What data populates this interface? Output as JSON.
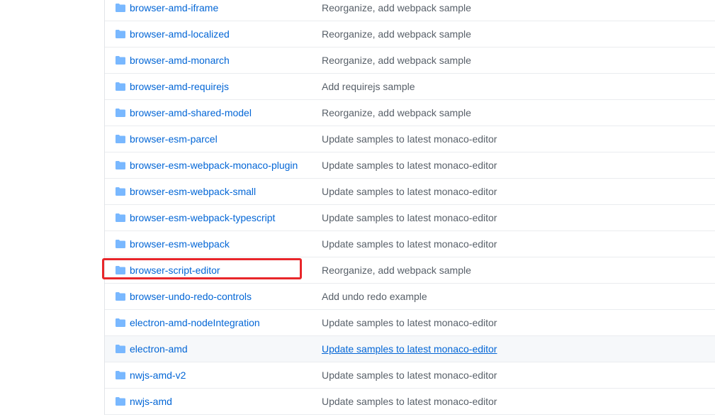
{
  "file_list": {
    "rows": [
      {
        "icon": "folder-icon",
        "name": "browser-amd-iframe",
        "message": "Reorganize, add webpack sample"
      },
      {
        "icon": "folder-icon",
        "name": "browser-amd-localized",
        "message": "Reorganize, add webpack sample"
      },
      {
        "icon": "folder-icon",
        "name": "browser-amd-monarch",
        "message": "Reorganize, add webpack sample"
      },
      {
        "icon": "folder-icon",
        "name": "browser-amd-requirejs",
        "message": "Add requirejs sample"
      },
      {
        "icon": "folder-icon",
        "name": "browser-amd-shared-model",
        "message": "Reorganize, add webpack sample"
      },
      {
        "icon": "folder-icon",
        "name": "browser-esm-parcel",
        "message": "Update samples to latest monaco-editor"
      },
      {
        "icon": "folder-icon",
        "name": "browser-esm-webpack-monaco-plugin",
        "message": "Update samples to latest monaco-editor"
      },
      {
        "icon": "folder-icon",
        "name": "browser-esm-webpack-small",
        "message": "Update samples to latest monaco-editor"
      },
      {
        "icon": "folder-icon",
        "name": "browser-esm-webpack-typescript",
        "message": "Update samples to latest monaco-editor"
      },
      {
        "icon": "folder-icon",
        "name": "browser-esm-webpack",
        "message": "Update samples to latest monaco-editor"
      },
      {
        "icon": "folder-icon",
        "name": "browser-script-editor",
        "message": "Reorganize, add webpack sample"
      },
      {
        "icon": "folder-icon",
        "name": "browser-undo-redo-controls",
        "message": "Add undo redo example"
      },
      {
        "icon": "folder-icon",
        "name": "electron-amd-nodeIntegration",
        "message": "Update samples to latest monaco-editor"
      },
      {
        "icon": "folder-icon",
        "name": "electron-amd",
        "message": "Update samples to latest monaco-editor"
      },
      {
        "icon": "folder-icon",
        "name": "nwjs-amd-v2",
        "message": "Update samples to latest monaco-editor"
      },
      {
        "icon": "folder-icon",
        "name": "nwjs-amd",
        "message": "Update samples to latest monaco-editor"
      }
    ]
  },
  "colors": {
    "link": "#0366d6",
    "message": "#586069",
    "folder_icon": "#79b8ff",
    "row_border": "#eaecef",
    "hover_background": "#f6f8fa",
    "highlight_border": "#e8262a"
  }
}
